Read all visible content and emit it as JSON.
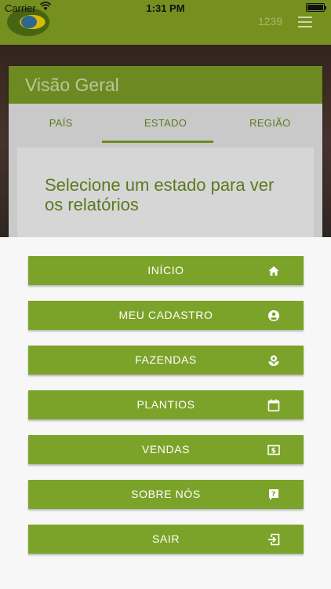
{
  "status_bar": {
    "carrier": "Carrier",
    "time": "1:31 PM"
  },
  "app_bar": {
    "counter": "1239"
  },
  "overview": {
    "title": "Visão Geral",
    "tabs": [
      {
        "label": "PAÍS"
      },
      {
        "label": "ESTADO",
        "active": true
      },
      {
        "label": "REGIÃO"
      }
    ],
    "message": "Selecione um estado para ver os relatórios"
  },
  "drawer": {
    "items": [
      {
        "label": "INÍCIO",
        "icon": "home-icon"
      },
      {
        "label": "MEU CADASTRO",
        "icon": "account-circle-icon"
      },
      {
        "label": "FAZENDAS",
        "icon": "flower-icon"
      },
      {
        "label": "PLANTIOS",
        "icon": "calendar-icon"
      },
      {
        "label": "VENDAS",
        "icon": "money-icon"
      },
      {
        "label": "SOBRE NÓS",
        "icon": "help-icon"
      },
      {
        "label": "SAIR",
        "icon": "exit-icon"
      }
    ]
  },
  "colors": {
    "primary": "#7ca329",
    "drawer_bg": "#f7f7f7"
  }
}
